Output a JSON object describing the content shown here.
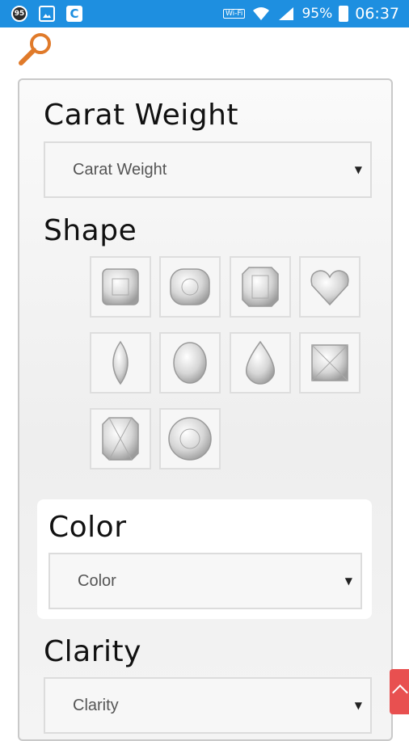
{
  "status_bar": {
    "badge": "95",
    "wifi_label": "Wi-Fi",
    "battery": "95%",
    "time": "06:37"
  },
  "filters": {
    "carat": {
      "heading": "Carat Weight",
      "placeholder": "Carat Weight"
    },
    "shape": {
      "heading": "Shape",
      "options": [
        "asscher",
        "cushion",
        "emerald",
        "heart",
        "marquise",
        "oval",
        "pear",
        "princess",
        "radiant",
        "round"
      ]
    },
    "color": {
      "heading": "Color",
      "placeholder": "Color"
    },
    "clarity": {
      "heading": "Clarity",
      "placeholder": "Clarity"
    }
  },
  "icons": {
    "search": "search-icon",
    "caret": "chevron-down-icon",
    "scroll_top": "arrow-up-icon"
  },
  "colors": {
    "status_bar": "#1e8fe0",
    "search_icon": "#e07a2a",
    "scroll_top": "#e85050"
  }
}
